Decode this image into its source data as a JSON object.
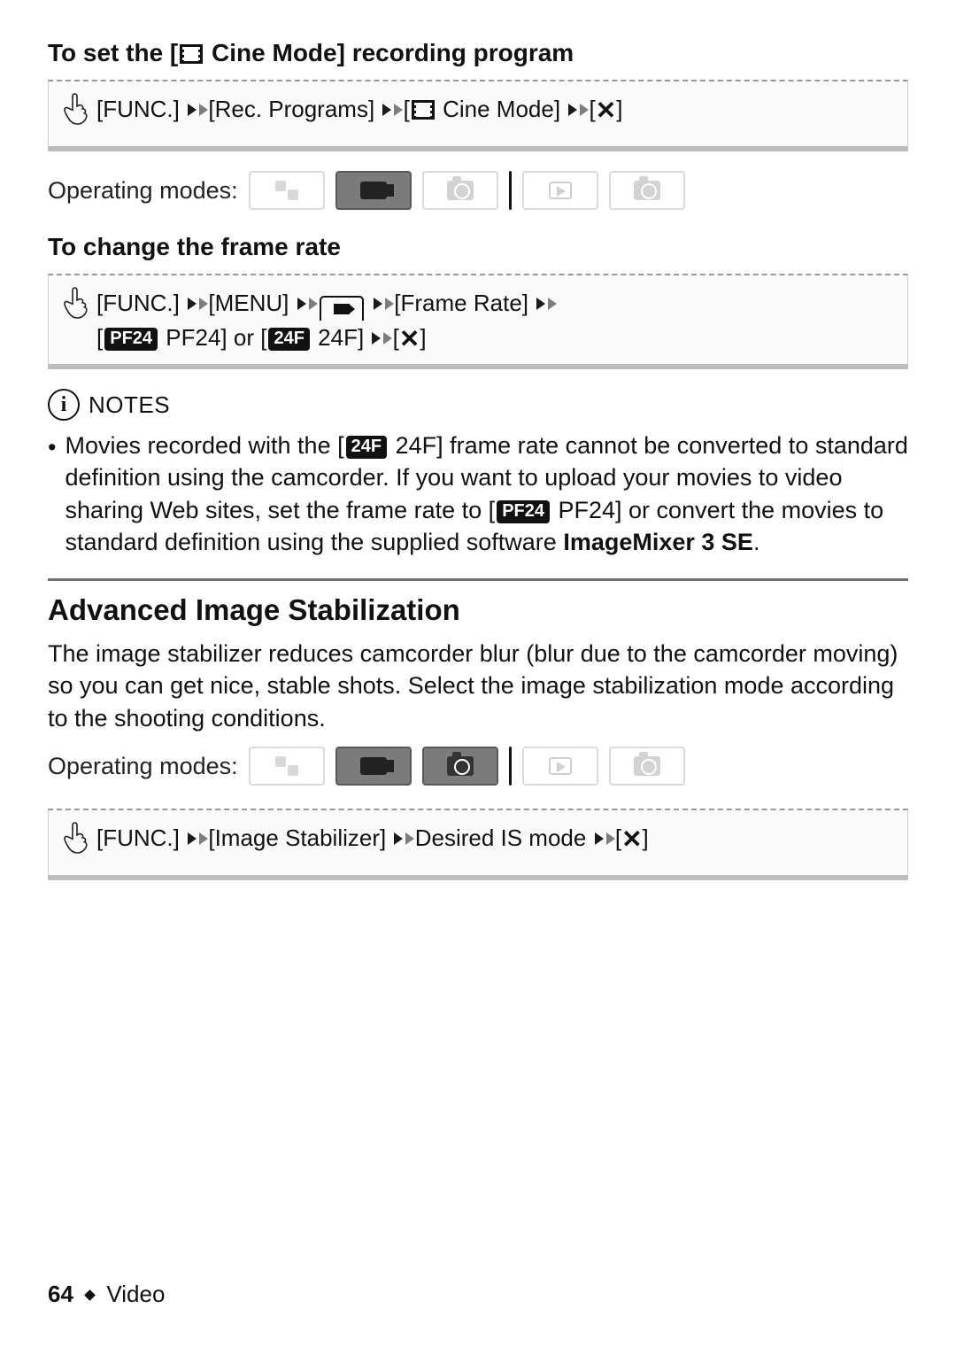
{
  "section_cine": {
    "heading_pre": "To set the [",
    "heading_post": " Cine Mode] recording program",
    "seq": {
      "func": "[FUNC.]",
      "rec_programs": "[Rec. Programs]",
      "cine_pre": "[",
      "cine_post": " Cine Mode]",
      "close_pre": "[",
      "close_post": "]"
    }
  },
  "operating_modes_label": "Operating modes:",
  "section_framerate": {
    "heading": "To change the frame rate",
    "seq": {
      "func": "[FUNC.]",
      "menu": "[MENU]",
      "frame_rate": "[Frame Rate]",
      "opt1_pre": "[",
      "opt1_badge": "PF24",
      "opt1_post": " PF24]",
      "or": " or ",
      "opt2_pre": "[",
      "opt2_badge": "24F",
      "opt2_post": " 24F]",
      "close_pre": "[",
      "close_post": "]"
    }
  },
  "notes": {
    "label": "NOTES",
    "item1_pre": "Movies recorded with the [",
    "item1_badge": "24F",
    "item1_mid1": " 24F] frame rate cannot be converted to standard definition using the camcorder. If you want to upload your movies to video sharing Web sites, set the frame rate to [",
    "item1_badge2": "PF24",
    "item1_mid2": " PF24] or convert the movies to standard definition using the supplied software ",
    "item1_bold": "ImageMixer 3 SE",
    "item1_end": "."
  },
  "section_is": {
    "heading": "Advanced Image Stabilization",
    "para": "The image stabilizer reduces camcorder blur (blur due to the camcorder moving) so you can get nice, stable shots. Select the image stabilization mode according to the shooting conditions.",
    "seq": {
      "func": "[FUNC.]",
      "stab": "[Image Stabilizer]",
      "desired": "Desired IS mode",
      "close_pre": "[",
      "close_post": "]"
    }
  },
  "footer": {
    "page": "64",
    "chapter": "Video"
  }
}
